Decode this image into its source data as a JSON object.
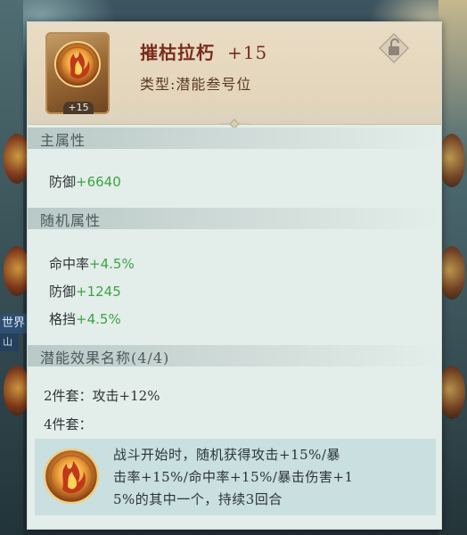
{
  "background": {
    "world_label": "世界",
    "world_sub": "山"
  },
  "item": {
    "name": "摧枯拉朽",
    "level": "+15",
    "type_line": "类型:潜能叁号位",
    "badge": "+15",
    "icon": "flame-phoenix-emblem-icon",
    "lock_icon": "unlock-icon"
  },
  "main_attributes": {
    "label": "主属性",
    "stats": [
      {
        "name": "防御",
        "value": "+6640"
      }
    ]
  },
  "random_attributes": {
    "label": "随机属性",
    "stats": [
      {
        "name": "命中率",
        "value": "+4.5%"
      },
      {
        "name": "防御",
        "value": "+1245"
      },
      {
        "name": "格挡",
        "value": "+4.5%"
      }
    ]
  },
  "potential_effect": {
    "label": "潜能效果名称(4/4)",
    "set2": "2件套：攻击+12%",
    "set4": "4件套：",
    "set4_lines": [
      "战斗开始时，随机获得攻击+15%/暴",
      "击率+15%/命中率+15%/暴击伤害+1",
      "5%的其中一个，持续3回合"
    ]
  },
  "colors": {
    "title": "#7a2c1c",
    "stat_value": "#3ca346",
    "panel_bg": "#e3ede9",
    "header_bg": "#e6d9c0"
  }
}
